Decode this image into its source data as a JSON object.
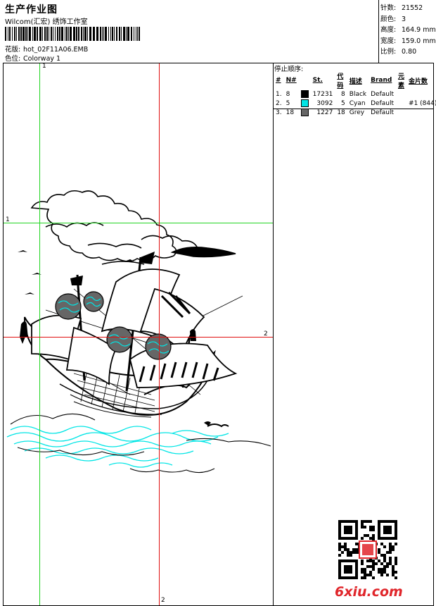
{
  "header": {
    "title": "生产作业图",
    "company": "Wilcom(汇宏) 绣饰工作室",
    "design_label": "花版:",
    "design_value": "hot_02F11A06.EMB",
    "colorway_label": "色位:",
    "colorway_value": "Colorway 1"
  },
  "stats": [
    {
      "label": "针数:",
      "value": "21552"
    },
    {
      "label": "颜色:",
      "value": "3"
    },
    {
      "label": "高度:",
      "value": "164.9 mm"
    },
    {
      "label": "宽度:",
      "value": "159.0 mm"
    },
    {
      "label": "比例:",
      "value": "0.80"
    }
  ],
  "stop_sequence": {
    "title": "停止顺序:",
    "headers": [
      "#",
      "N#",
      "St.",
      "代码",
      "描述",
      "Brand",
      "元素",
      "金片数"
    ],
    "rows": [
      {
        "index": "1.",
        "needle": "8",
        "color": "#000000",
        "stitches": "17231",
        "code": "8",
        "desc": "Black",
        "brand": "Default",
        "element": "",
        "sequins": ""
      },
      {
        "index": "2.",
        "needle": "5",
        "color": "#00e5e5",
        "stitches": "3092",
        "code": "5",
        "desc": "Cyan",
        "brand": "Default",
        "element": "",
        "sequins": "#1 (844)"
      },
      {
        "index": "3.",
        "needle": "18",
        "color": "#666666",
        "stitches": "1227",
        "code": "18",
        "desc": "Grey",
        "brand": "Default",
        "element": "",
        "sequins": ""
      }
    ]
  },
  "guides": {
    "top": "1",
    "left": "1",
    "right": "2",
    "bottom": "2"
  },
  "watermark": "6xiu.com",
  "colors": {
    "guide_green": "#1fd41f",
    "guide_red": "#e01010",
    "cyan": "#00e5e5",
    "grey": "#666666"
  }
}
